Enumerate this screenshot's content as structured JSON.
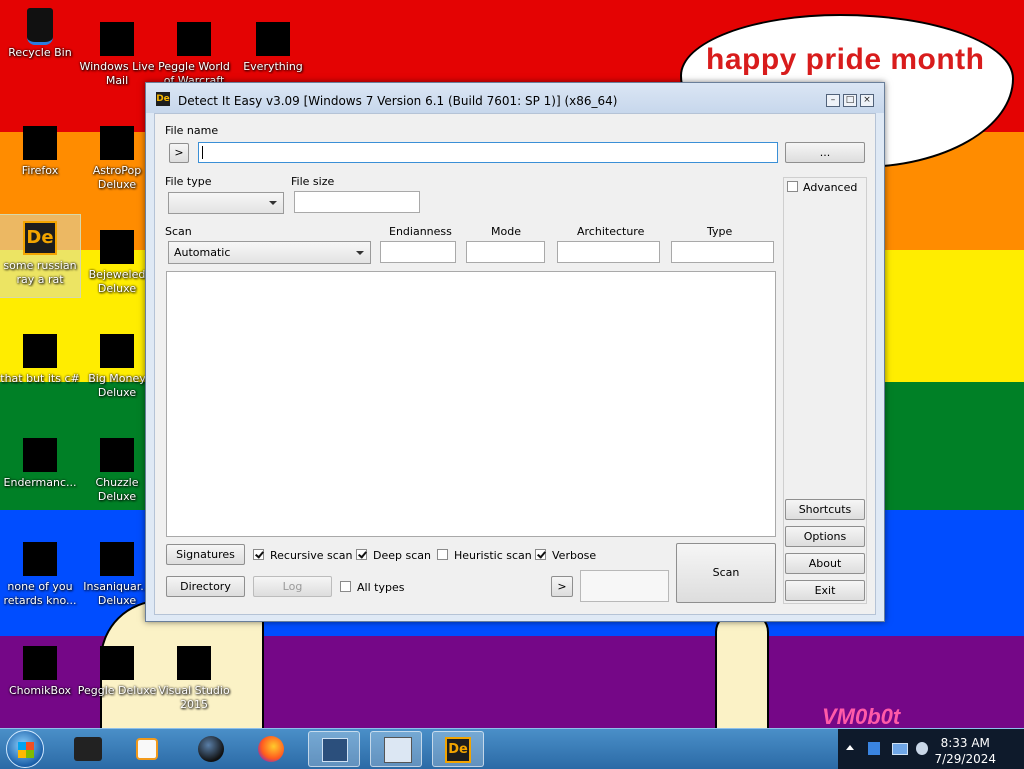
{
  "desktop": {
    "bubble_text": "happy pride month",
    "watermark": "VM0b0t",
    "stripe_colors": [
      "#e40303",
      "#ff8c00",
      "#ffed00",
      "#008026",
      "#004dff",
      "#750787"
    ],
    "icons": [
      {
        "label": "Recycle Bin",
        "icon": "recycle-bin-icon"
      },
      {
        "label": "Windows Live Mail",
        "icon": "mail-icon"
      },
      {
        "label": "Peggle World of Warcraft",
        "icon": "game-icon"
      },
      {
        "label": "Everything",
        "icon": "search-icon"
      },
      {
        "label": "Firefox",
        "icon": "firefox-icon"
      },
      {
        "label": "AstroPop Deluxe",
        "icon": "game-icon"
      },
      {
        "label": "some russian ray a rat",
        "icon": "die-icon"
      },
      {
        "label": "Bejeweled Deluxe",
        "icon": "game-icon"
      },
      {
        "label": "that but its c#",
        "icon": "folder-icon"
      },
      {
        "label": "Big Money Deluxe",
        "icon": "game-icon"
      },
      {
        "label": "Endermanc...",
        "icon": "app-icon"
      },
      {
        "label": "Chuzzle Deluxe",
        "icon": "game-icon"
      },
      {
        "label": "none of you retards kno...",
        "icon": "app-icon"
      },
      {
        "label": "Insaniquar... Deluxe",
        "icon": "game-icon"
      },
      {
        "label": "ChomikBox",
        "icon": "app-icon"
      },
      {
        "label": "Peggle Deluxe",
        "icon": "game-icon"
      },
      {
        "label": "Visual Studio 2015",
        "icon": "visual-studio-icon"
      }
    ]
  },
  "window": {
    "title": "Detect It Easy v3.09 [Windows 7 Version 6.1 (Build 7601: SP 1)] (x86_64)",
    "app_icon_text": "De",
    "file_name_label": "File name",
    "file_name_value": "",
    "browse_label": "...",
    "arrow_label": ">",
    "file_type_label": "File type",
    "file_size_label": "File size",
    "advanced_label": "Advanced",
    "scan_label": "Scan",
    "scan_value": "Automatic",
    "columns": [
      "Endianness",
      "Mode",
      "Architecture",
      "Type"
    ],
    "buttons": {
      "signatures": "Signatures",
      "directory": "Directory",
      "log": "Log",
      "scan": "Scan",
      "shortcuts": "Shortcuts",
      "options": "Options",
      "about": "About",
      "exit": "Exit",
      "next": ">"
    },
    "checks": {
      "recursive": "Recursive scan",
      "deep": "Deep scan",
      "heuristic": "Heuristic scan",
      "verbose": "Verbose",
      "all_types": "All types"
    }
  },
  "taskbar": {
    "time": "8:33 AM",
    "date": "7/29/2024"
  }
}
